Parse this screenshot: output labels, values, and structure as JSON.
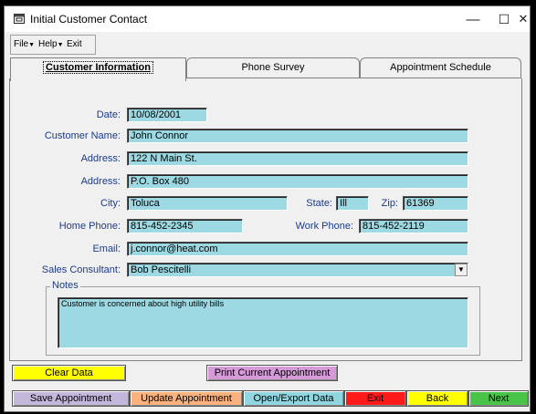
{
  "window": {
    "title": "Initial Customer Contact",
    "minimize_glyph": "—",
    "maximize_glyph": "☐",
    "close_glyph": "✕"
  },
  "menu": [
    {
      "label": "File",
      "has_arrow": true
    },
    {
      "label": "Help",
      "has_arrow": true
    },
    {
      "label": "Exit",
      "has_arrow": false
    }
  ],
  "tabs": [
    {
      "label": "Customer Information",
      "active": true
    },
    {
      "label": "Phone Survey",
      "active": false
    },
    {
      "label": "Appointment Schedule",
      "active": false
    }
  ],
  "form": {
    "date": {
      "label": "Date:",
      "value": "10/08/2001"
    },
    "customer_name": {
      "label": "Customer Name:",
      "value": "John Connor"
    },
    "address1": {
      "label": "Address:",
      "value": "122 N Main St."
    },
    "address2": {
      "label": "Address:",
      "value": "P.O. Box 480"
    },
    "city": {
      "label": "City:",
      "value": "Toluca"
    },
    "state": {
      "label": "State:",
      "value": "Ill"
    },
    "zip": {
      "label": "Zip:",
      "value": "61369"
    },
    "home_phone": {
      "label": "Home Phone:",
      "value": "815-452-2345"
    },
    "work_phone": {
      "label": "Work Phone:",
      "value": "815-452-2119"
    },
    "email": {
      "label": "Email:",
      "value": "j.connor@heat.com"
    },
    "sales_consultant": {
      "label": "Sales Consultant:",
      "value": "Bob Pescitelli"
    },
    "notes": {
      "label": "Notes",
      "value": "Customer is concerned about high utility bills"
    }
  },
  "buttons": {
    "clear": {
      "label": "Clear Data",
      "color": "#ffff00"
    },
    "print": {
      "label": "Print Current Appointment",
      "color": "#d79ad9"
    },
    "save": {
      "label": "Save Appointment",
      "color": "#c3b7dc"
    },
    "update": {
      "label": "Update Appointment",
      "color": "#f9b27d"
    },
    "open_export": {
      "label": "Open/Export Data",
      "color": "#8fd6e0"
    },
    "exit": {
      "label": "Exit",
      "color": "#ff1a1a"
    },
    "back": {
      "label": "Back",
      "color": "#ffff00"
    },
    "next": {
      "label": "Next",
      "color": "#49c449"
    }
  },
  "colors": {
    "field_bg": "#9dd9e2",
    "label_text": "#1a3a8a"
  }
}
